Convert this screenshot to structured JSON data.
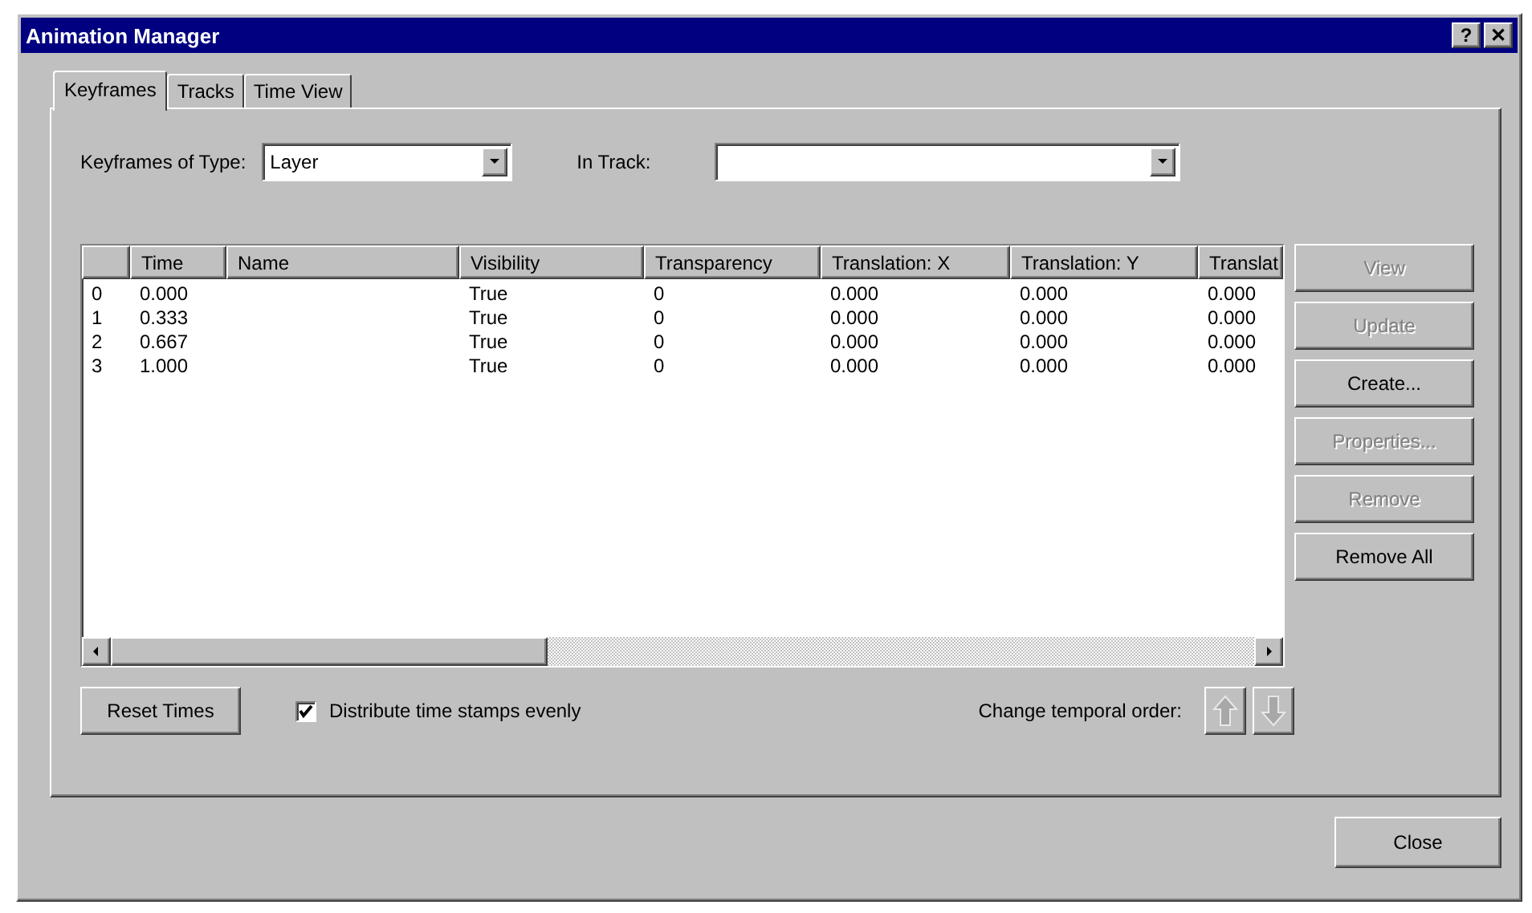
{
  "window": {
    "title": "Animation Manager",
    "controls": [
      "?",
      "✕"
    ]
  },
  "tabs": [
    {
      "label": "Keyframes",
      "selected": true
    },
    {
      "label": "Tracks",
      "selected": false
    },
    {
      "label": "Time View",
      "selected": false
    }
  ],
  "filters": {
    "type_label": "Keyframes of Type:",
    "type_value": "Layer",
    "track_label": "In Track:"
  },
  "table": {
    "columns": [
      "",
      "Time",
      "Name",
      "Visibility",
      "Transparency",
      "Translation: X",
      "Translation: Y",
      "Translat"
    ],
    "rows": [
      [
        "0",
        "0.000",
        "",
        "True",
        "0",
        "0.000",
        "0.000",
        "0.000"
      ],
      [
        "1",
        "0.333",
        "",
        "True",
        "0",
        "0.000",
        "0.000",
        "0.000"
      ],
      [
        "2",
        "0.667",
        "",
        "True",
        "0",
        "0.000",
        "0.000",
        "0.000"
      ],
      [
        "3",
        "1.000",
        "",
        "True",
        "0",
        "0.000",
        "0.000",
        "0.000"
      ]
    ]
  },
  "side_buttons": [
    {
      "label": "View",
      "disabled": true
    },
    {
      "label": "Update",
      "disabled": true
    },
    {
      "label": "Create...",
      "disabled": false
    },
    {
      "label": "Properties...",
      "disabled": true
    },
    {
      "label": "Remove",
      "disabled": true
    },
    {
      "label": "Remove All",
      "disabled": false
    }
  ],
  "reset_button": "Reset Times",
  "distribute": {
    "label": "Distribute time stamps evenly",
    "checked": true
  },
  "order": {
    "label": "Change temporal order:",
    "up_disabled": true,
    "down_disabled": true
  },
  "close_button": "Close"
}
